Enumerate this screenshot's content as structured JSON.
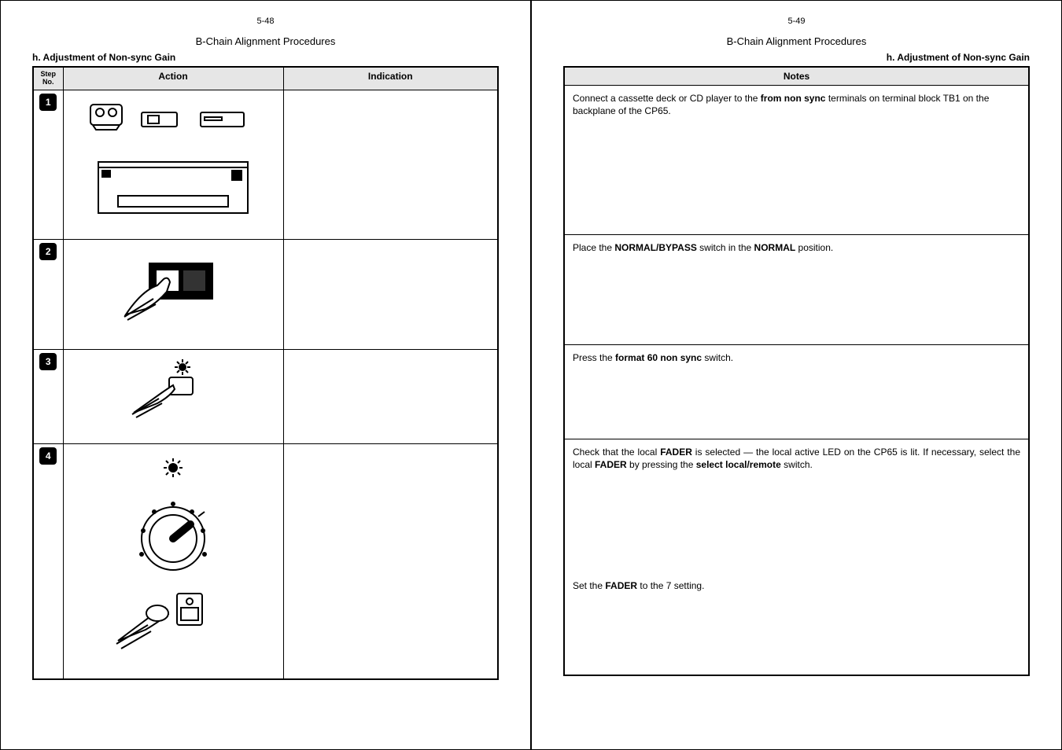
{
  "left": {
    "pageNum": "5-48",
    "title": "B-Chain Alignment Procedures",
    "subtitle": "h.  Adjustment of Non-sync Gain",
    "headers": {
      "step": "Step\nNo.",
      "action": "Action",
      "indication": "Indication"
    },
    "steps": [
      "1",
      "2",
      "3",
      "4"
    ]
  },
  "right": {
    "pageNum": "5-49",
    "title": "B-Chain Alignment Procedures",
    "subtitle": "h.  Adjustment of Non-sync Gain",
    "notesHeader": "Notes",
    "notes": {
      "n1_a": "Connect a cassette deck or CD player to the ",
      "n1_b": "from non sync",
      "n1_c": " terminals on terminal block TB1 on the backplane of the CP65.",
      "n2_a": "Place the ",
      "n2_b": "NORMAL/BYPASS",
      "n2_c": " switch in the ",
      "n2_d": "NORMAL",
      "n2_e": " position.",
      "n3_a": "Press the ",
      "n3_b": "format 60 non sync",
      "n3_c": " switch.",
      "n4_a": "Check that the local ",
      "n4_b": "FADER",
      "n4_c": " is selected — the local active LED on the CP65 is lit.  If necessary, select the local ",
      "n4_d": "FADER",
      "n4_e": " by pressing the ",
      "n4_f": "select local/remote",
      "n4_g": " switch.",
      "n5_a": "Set the ",
      "n5_b": "FADER",
      "n5_c": " to the 7 setting."
    }
  }
}
